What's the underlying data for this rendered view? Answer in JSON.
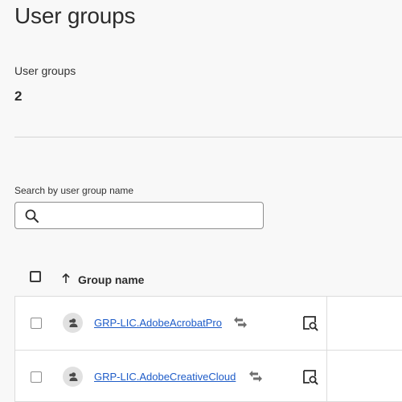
{
  "page": {
    "title": "User groups"
  },
  "stats": {
    "label": "User groups",
    "value": "2"
  },
  "search": {
    "label": "Search by user group name",
    "value": "",
    "placeholder": ""
  },
  "table": {
    "columns": [
      {
        "label": "Group name",
        "sort": "ascending"
      }
    ],
    "rows": [
      {
        "name": "GRP-LIC.AdobeAcrobatPro"
      },
      {
        "name": "GRP-LIC.AdobeCreativeCloud"
      }
    ]
  },
  "icons": {
    "search": "search-icon",
    "sort": "arrow-up-icon",
    "avatar": "user-group-icon",
    "sync": "sync-arrows-icon",
    "view": "view-details-icon"
  },
  "colors": {
    "link": "#1e5cc8",
    "background": "#f8f8f8",
    "row_background": "#ffffff",
    "border": "#dcdcdc"
  }
}
